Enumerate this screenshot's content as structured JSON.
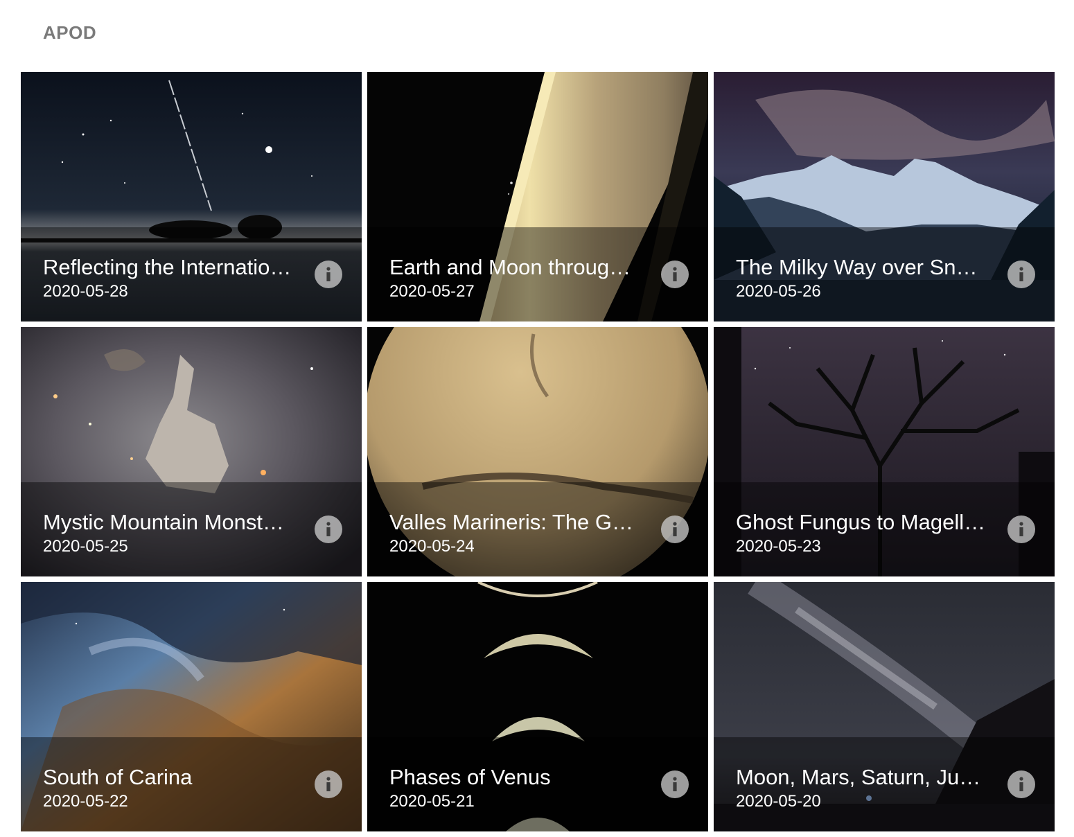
{
  "app": {
    "title": "APOD"
  },
  "tiles": [
    {
      "title": "Reflecting the Internatio…",
      "date": "2020-05-28",
      "image": "night-sky-lake-satellite-trail"
    },
    {
      "title": "Earth and Moon throug…",
      "date": "2020-05-27",
      "image": "saturn-rings"
    },
    {
      "title": "The Milky Way over Sno…",
      "date": "2020-05-26",
      "image": "milky-way-snowy-mountains"
    },
    {
      "title": "Mystic Mountain Monst…",
      "date": "2020-05-25",
      "image": "nebula-pillar"
    },
    {
      "title": "Valles Marineris: The Gr…",
      "date": "2020-05-24",
      "image": "mars-globe"
    },
    {
      "title": "Ghost Fungus to Magell…",
      "date": "2020-05-23",
      "image": "tree-silhouette-starry-sky"
    },
    {
      "title": "South of Carina",
      "date": "2020-05-22",
      "image": "carina-nebula"
    },
    {
      "title": "Phases of Venus",
      "date": "2020-05-21",
      "image": "venus-crescent-phases"
    },
    {
      "title": "Moon, Mars, Saturn, Ju…",
      "date": "2020-05-20",
      "image": "milky-way-beach"
    }
  ],
  "icons": {
    "info": "info-icon"
  }
}
